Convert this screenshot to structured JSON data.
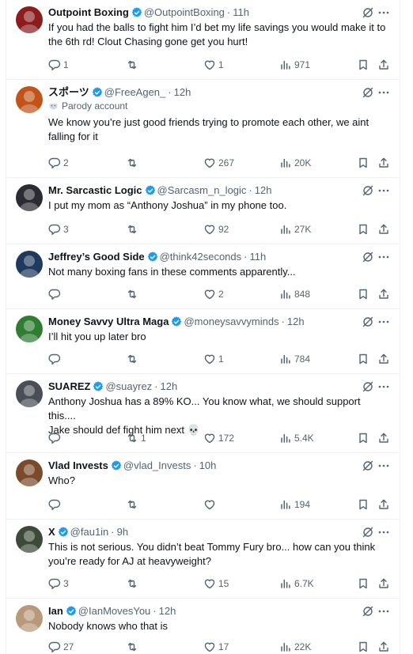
{
  "feed": {
    "tweets": [
      {
        "name": "Outpoint Boxing",
        "handle": "@OutpointBoxing",
        "time": "11h",
        "verified": true,
        "parody": "",
        "text": [
          "If you had the balls to fight him I’d bet my life savings you would make it to",
          "the 6th rd! Clout Chasing gone get you hurt!"
        ],
        "replies": "1",
        "retweets": "",
        "likes": "1",
        "views": "971",
        "avatar_color": "#8b1d1d"
      },
      {
        "name": "スポーツ",
        "handle": "@FreeAgen_",
        "time": "12h",
        "verified": true,
        "parody": "Parody account",
        "text": [
          "We know you’re just good friends trying to promote each other, we aint",
          "falling for it"
        ],
        "replies": "2",
        "retweets": "",
        "likes": "267",
        "views": "20K",
        "avatar_color": "#c2541a"
      },
      {
        "name": "Mr. Sarcastic Logic",
        "handle": "@Sarcasm_n_logic",
        "time": "12h",
        "verified": true,
        "parody": "",
        "text": [
          "I put my mom as “Anthony Joshua” in my phone too."
        ],
        "replies": "3",
        "retweets": "",
        "likes": "92",
        "views": "27K",
        "avatar_color": "#2b2b33"
      },
      {
        "name": "Jeffrey’s Good Side",
        "handle": "@think42seconds",
        "time": "11h",
        "verified": true,
        "parody": "",
        "text": [
          "Not many boxing fans in these comments apparently..."
        ],
        "replies": "",
        "retweets": "",
        "likes": "2",
        "views": "848",
        "avatar_color": "#1e3a5f"
      },
      {
        "name": "Money Savvy Ultra Maga",
        "handle": "@moneysavvyminds",
        "time": "12h",
        "verified": true,
        "parody": "",
        "text": [
          "I’ll hit you up later bro"
        ],
        "replies": "",
        "retweets": "",
        "likes": "1",
        "views": "784",
        "avatar_color": "#2f7d32"
      },
      {
        "name": "SUAREZ",
        "handle": "@suayrez",
        "time": "12h",
        "verified": true,
        "parody": "",
        "text": [
          "Anthony Joshua has a 89% KO... You know what, we should support this....",
          "Jake should def fight him next 💀"
        ],
        "replies": "",
        "retweets": "1",
        "likes": "172",
        "views": "5.4K",
        "avatar_color": "#4a4f57"
      },
      {
        "name": "Vlad Invests",
        "handle": "@vlad_Invests",
        "time": "10h",
        "verified": true,
        "parody": "",
        "text": [
          "Who?"
        ],
        "replies": "",
        "retweets": "",
        "likes": "",
        "views": "194",
        "avatar_color": "#7a4a2a"
      },
      {
        "name": "X",
        "handle": "@fau1in",
        "time": "9h",
        "verified": true,
        "parody": "",
        "text": [
          "This is not serious. You didn’t beat Tommy Fury bro... how can you think",
          "you’re ready for AJ at heavyweight?"
        ],
        "replies": "3",
        "retweets": "",
        "likes": "15",
        "views": "6.7K",
        "avatar_color": "#3d4a3a"
      },
      {
        "name": "Ian",
        "handle": "@IanMovesYou",
        "time": "12h",
        "verified": true,
        "parody": "",
        "text": [
          "Nobody knows who that is"
        ],
        "replies": "27",
        "retweets": "",
        "likes": "17",
        "views": "22K",
        "avatar_color": "#b89a7a"
      }
    ]
  },
  "colors": {
    "verified": "#1d9bf0",
    "text": "#0f1419",
    "muted": "#536471",
    "divider": "#eff3f4"
  },
  "icons": [
    "reply-icon",
    "retweet-icon",
    "like-icon",
    "views-icon",
    "bookmark-icon",
    "share-icon",
    "grok-icon",
    "more-icon",
    "verified-badge-icon",
    "parody-mask-icon"
  ]
}
